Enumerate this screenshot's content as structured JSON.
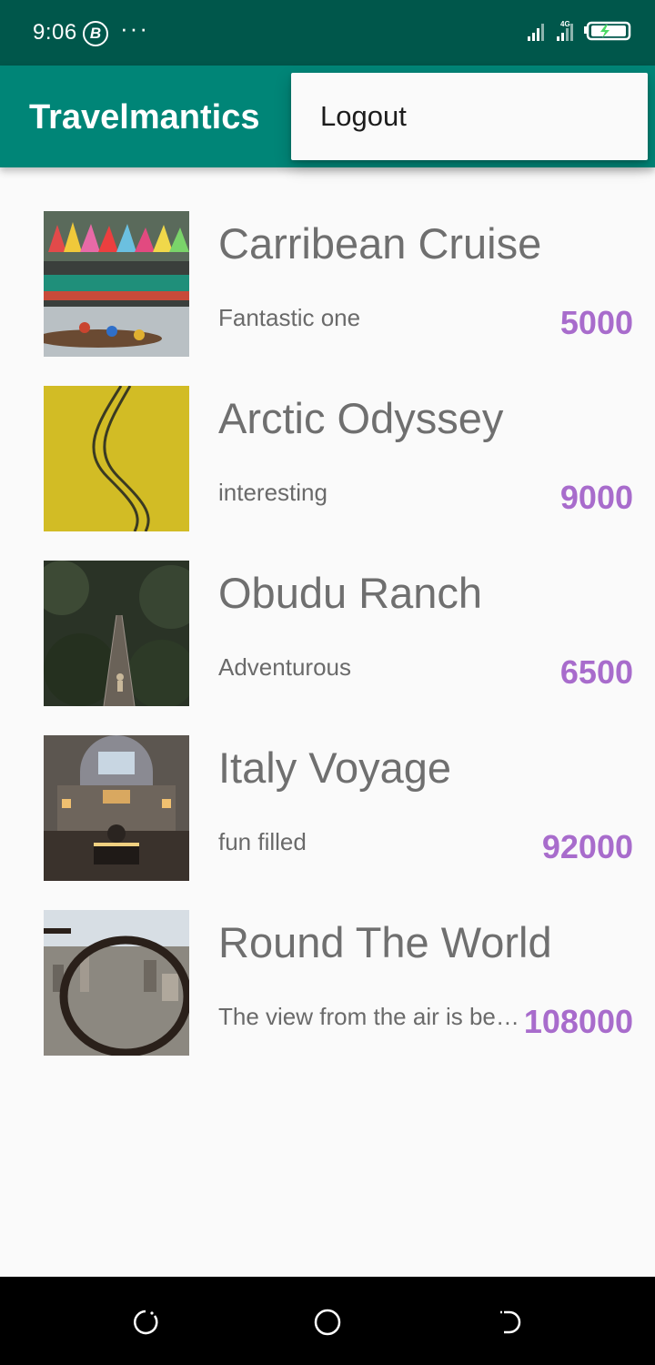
{
  "status_bar": {
    "time": "9:06",
    "badge": "B",
    "more": "···",
    "network": "4G",
    "colors": {
      "background": "#00574b",
      "battery_bolt": "#4cd964"
    }
  },
  "app_bar": {
    "title": "Travelmantics",
    "color": "#008577"
  },
  "overflow_menu": {
    "items": [
      {
        "label": "Logout"
      }
    ]
  },
  "deals": [
    {
      "title": "Carribean Cruise",
      "description": "Fantastic one",
      "price": "5000",
      "image": "dragon-boat-festival"
    },
    {
      "title": "Arctic Odyssey",
      "description": "interesting",
      "price": "9000",
      "image": "yellow-field-tracks"
    },
    {
      "title": "Obudu Ranch",
      "description": "Adventurous",
      "price": "6500",
      "image": "forest-bridge"
    },
    {
      "title": "Italy Voyage",
      "description": "fun filled",
      "price": "92000",
      "image": "museum-hall"
    },
    {
      "title": "Round The World",
      "description": "The view from the air is beautiful",
      "price": "108000",
      "image": "city-through-glasses"
    }
  ],
  "price_color": "#a86ccc",
  "nav_bar": {
    "buttons": [
      "recent-apps",
      "home",
      "back"
    ]
  }
}
